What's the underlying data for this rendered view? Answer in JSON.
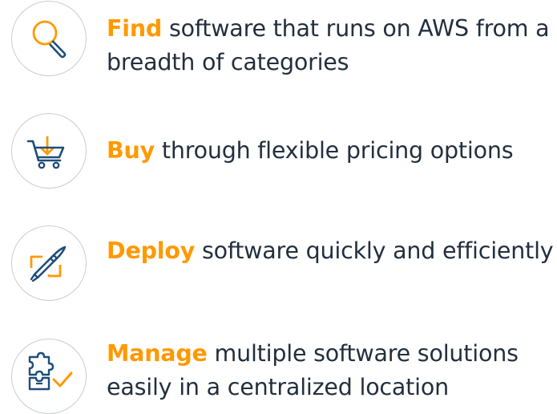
{
  "features": [
    {
      "icon": "magnifier-icon",
      "keyword": "Find",
      "description": " software that runs on AWS from a breadth of categories"
    },
    {
      "icon": "shopping-cart-download-icon",
      "keyword": "Buy",
      "description": " through flexible pricing options"
    },
    {
      "icon": "rocket-icon",
      "keyword": "Deploy",
      "description": " software quickly and efficiently"
    },
    {
      "icon": "puzzle-checkmark-icon",
      "keyword": "Manage",
      "description": " multiple software solutions easily in a centralized location"
    }
  ],
  "colors": {
    "accent": "#ff9900",
    "text": "#232f3e",
    "icon_stroke": "#1f4e79",
    "circle_border": "#c9cdd1"
  }
}
